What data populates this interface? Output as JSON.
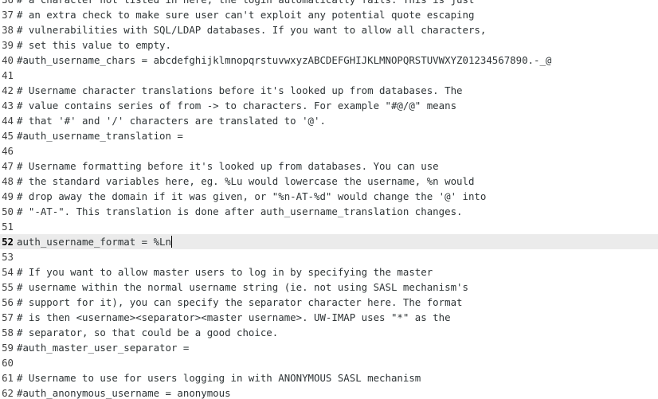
{
  "editor": {
    "current_line": "52",
    "lines": [
      {
        "num": "36",
        "text": "# a character not listed in here, the login automatically fails. This is just"
      },
      {
        "num": "37",
        "text": "# an extra check to make sure user can't exploit any potential quote escaping"
      },
      {
        "num": "38",
        "text": "# vulnerabilities with SQL/LDAP databases. If you want to allow all characters,"
      },
      {
        "num": "39",
        "text": "# set this value to empty."
      },
      {
        "num": "40",
        "text": "#auth_username_chars = abcdefghijklmnopqrstuvwxyzABCDEFGHIJKLMNOPQRSTUVWXYZ01234567890.-_@"
      },
      {
        "num": "41",
        "text": ""
      },
      {
        "num": "42",
        "text": "# Username character translations before it's looked up from databases. The"
      },
      {
        "num": "43",
        "text": "# value contains series of from -> to characters. For example \"#@/@\" means"
      },
      {
        "num": "44",
        "text": "# that '#' and '/' characters are translated to '@'."
      },
      {
        "num": "45",
        "text": "#auth_username_translation ="
      },
      {
        "num": "46",
        "text": ""
      },
      {
        "num": "47",
        "text": "# Username formatting before it's looked up from databases. You can use"
      },
      {
        "num": "48",
        "text": "# the standard variables here, eg. %Lu would lowercase the username, %n would"
      },
      {
        "num": "49",
        "text": "# drop away the domain if it was given, or \"%n-AT-%d\" would change the '@' into"
      },
      {
        "num": "50",
        "text": "# \"-AT-\". This translation is done after auth_username_translation changes."
      },
      {
        "num": "51",
        "text": ""
      },
      {
        "num": "52",
        "text": "auth_username_format = %Ln"
      },
      {
        "num": "53",
        "text": ""
      },
      {
        "num": "54",
        "text": "# If you want to allow master users to log in by specifying the master"
      },
      {
        "num": "55",
        "text": "# username within the normal username string (ie. not using SASL mechanism's"
      },
      {
        "num": "56",
        "text": "# support for it), you can specify the separator character here. The format"
      },
      {
        "num": "57",
        "text": "# is then <username><separator><master username>. UW-IMAP uses \"*\" as the"
      },
      {
        "num": "58",
        "text": "# separator, so that could be a good choice."
      },
      {
        "num": "59",
        "text": "#auth_master_user_separator ="
      },
      {
        "num": "60",
        "text": ""
      },
      {
        "num": "61",
        "text": "# Username to use for users logging in with ANONYMOUS SASL mechanism"
      },
      {
        "num": "62",
        "text": "#auth_anonymous_username = anonymous"
      }
    ]
  }
}
